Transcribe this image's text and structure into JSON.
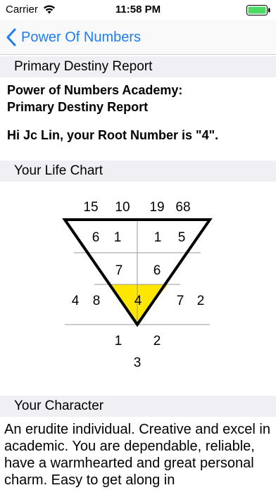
{
  "status_bar": {
    "carrier": "Carrier",
    "time": "11:58 PM"
  },
  "nav": {
    "back_label": "Power Of Numbers"
  },
  "sections": {
    "primary": "Primary Destiny Report",
    "life_chart": "Your Life Chart",
    "character": "Your Character"
  },
  "report": {
    "title_line1": "Power of Numbers Academy:",
    "title_line2": "Primary Destiny Report",
    "greeting": "Hi Jc Lin, your Root Number is \"4\"."
  },
  "life_chart": {
    "top": [
      "15",
      "10",
      "19",
      "68"
    ],
    "row1": [
      "6",
      "1",
      "1",
      "5"
    ],
    "row2": [
      "7",
      "6"
    ],
    "root": "4",
    "left": [
      "4",
      "8"
    ],
    "right": [
      "7",
      "2"
    ],
    "bottom": [
      "1",
      "2"
    ],
    "base": "3",
    "highlight_color": "#ffe600"
  },
  "character": {
    "text": "An erudite individual. Creative and excel in academic. You are dependable, reliable, have a warmhearted and great personal charm. Easy to get along in"
  }
}
